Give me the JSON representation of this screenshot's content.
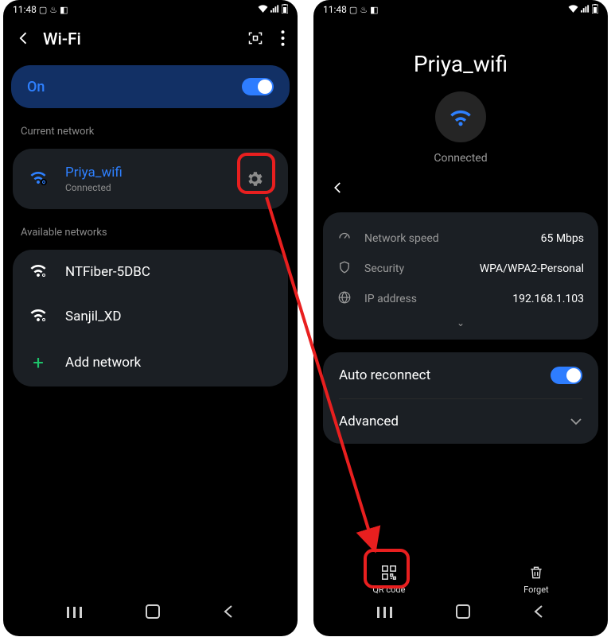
{
  "status": {
    "time": "11:48"
  },
  "left": {
    "title": "Wi-Fi",
    "toggle_label": "On",
    "section_current": "Current network",
    "current": {
      "ssid": "Priya_wifi",
      "status": "Connected"
    },
    "section_available": "Available networks",
    "available": [
      {
        "ssid": "NTFiber-5DBC"
      },
      {
        "ssid": "Sanjil_XD"
      }
    ],
    "add_network": "Add network"
  },
  "right": {
    "ssid": "Priya_wifi",
    "status": "Connected",
    "details": {
      "speed_label": "Network speed",
      "speed_value": "65 Mbps",
      "security_label": "Security",
      "security_value": "WPA/WPA2-Personal",
      "ip_label": "IP address",
      "ip_value": "192.168.1.103"
    },
    "auto_reconnect": "Auto reconnect",
    "advanced": "Advanced",
    "qr_label": "QR code",
    "forget_label": "Forget"
  }
}
